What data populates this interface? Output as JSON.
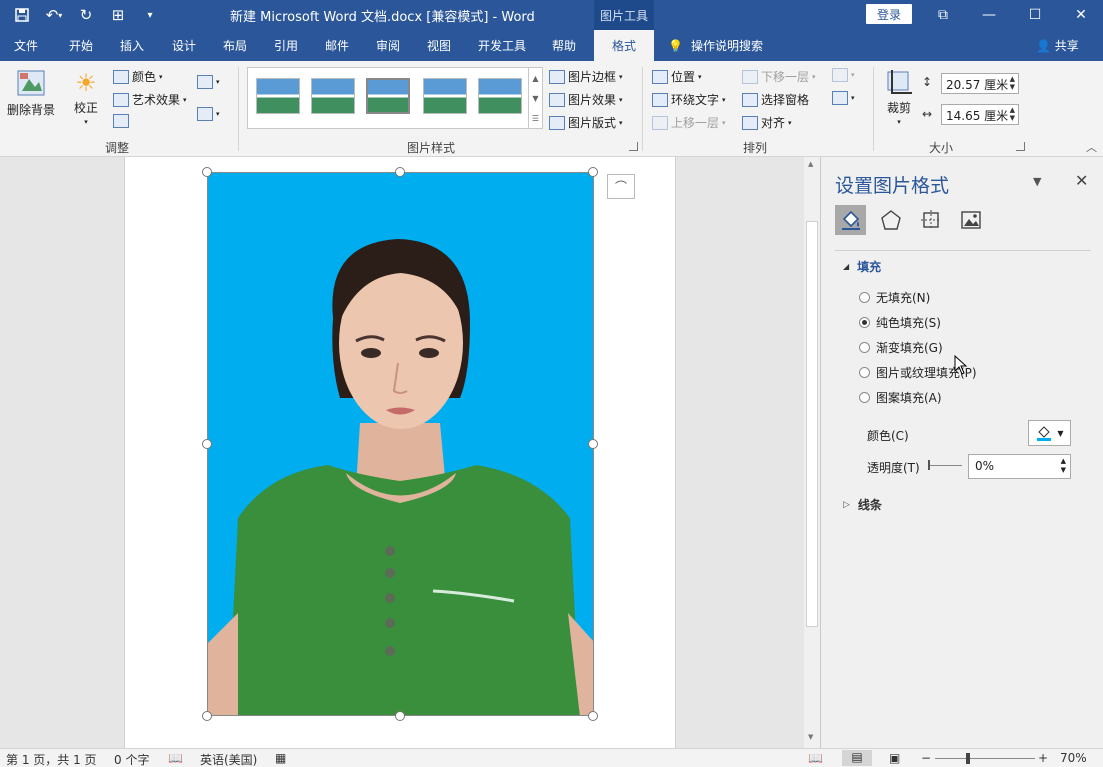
{
  "window": {
    "title": "新建 Microsoft Word 文档.docx [兼容模式]  -  Word",
    "context_tab_header": "图片工具",
    "login_label": "登录",
    "controls": [
      "minimize-icon",
      "maximize-icon",
      "close-icon"
    ],
    "ribbon_display_icon": "ribbon-display-icon"
  },
  "qat": [
    "save-icon",
    "undo-icon",
    "redo-icon",
    "touch-mode-icon",
    "customize-qat-icon"
  ],
  "tabs": [
    {
      "label": "文件"
    },
    {
      "label": "开始"
    },
    {
      "label": "插入"
    },
    {
      "label": "设计"
    },
    {
      "label": "布局"
    },
    {
      "label": "引用"
    },
    {
      "label": "邮件"
    },
    {
      "label": "审阅"
    },
    {
      "label": "视图"
    },
    {
      "label": "开发工具"
    },
    {
      "label": "帮助"
    },
    {
      "label": "格式",
      "active": true
    }
  ],
  "tell_me": "操作说明搜索",
  "share": "共享",
  "ribbon": {
    "remove_bg": "删除背景",
    "corrections": "校正",
    "color": "颜色",
    "artistic": "艺术效果",
    "group_adjust": "调整",
    "picture_border": "图片边框",
    "picture_effects": "图片效果",
    "picture_layout": "图片版式",
    "group_styles": "图片样式",
    "position": "位置",
    "wrap_text": "环绕文字",
    "bring_forward": "上移一层",
    "send_backward": "下移一层",
    "selection_pane": "选择窗格",
    "align": "对齐",
    "group_arrange": "排列",
    "crop": "裁剪",
    "height": "20.57 厘米",
    "width": "14.65 厘米",
    "group_size": "大小"
  },
  "pane": {
    "title": "设置图片格式",
    "fill_section": "填充",
    "fill_options": [
      {
        "label": "无填充(N)",
        "checked": false
      },
      {
        "label": "纯色填充(S)",
        "checked": true
      },
      {
        "label": "渐变填充(G)",
        "checked": false
      },
      {
        "label": "图片或纹理填充(P)",
        "checked": false
      },
      {
        "label": "图案填充(A)",
        "checked": false
      }
    ],
    "color_label": "颜色(C)",
    "transparency_label": "透明度(T)",
    "transparency_value": "0%",
    "line_section": "线条"
  },
  "status": {
    "page": "第 1 页，共 1 页",
    "words": "0 个字",
    "language": "英语(美国)",
    "zoom": "70%"
  },
  "colors": {
    "brand": "#2b579a",
    "photo_bg": "#00aeef",
    "shirt": "#3a8f3c"
  }
}
